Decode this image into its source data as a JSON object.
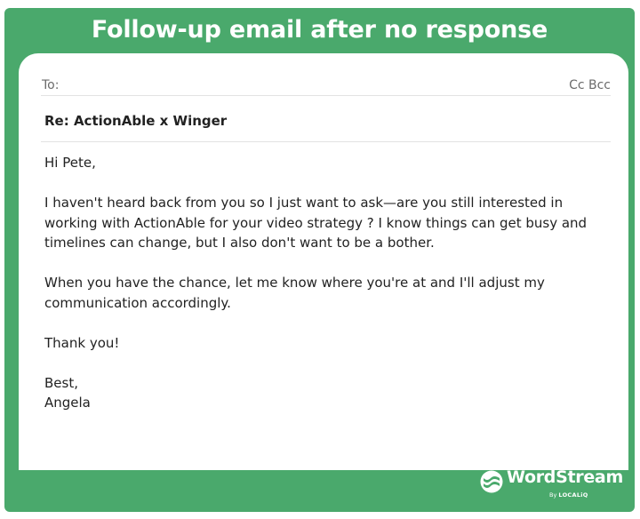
{
  "banner": {
    "title": "Follow-up email after no response"
  },
  "email": {
    "to_label": "To:",
    "cc_bcc_label": "Cc Bcc",
    "subject": "Re: ActionAble x Winger",
    "greeting": "Hi Pete,",
    "paragraph1": "I haven't heard back from you so I just want to ask—are you still interested in working with ActionAble for your video strategy ? I know things can get busy and timelines can change, but I also don't want to be a bother.",
    "paragraph2": "When you have the chance, let me know where you're at and I'll adjust my communication accordingly.",
    "thanks": "Thank you!",
    "signoff": "Best,",
    "signature": "Angela"
  },
  "brand": {
    "logo_text": "WordStream",
    "by_text": "By",
    "company": "LOCALiQ",
    "icon": "wordstream-logo-icon",
    "accent_color": "#4aa96c"
  }
}
